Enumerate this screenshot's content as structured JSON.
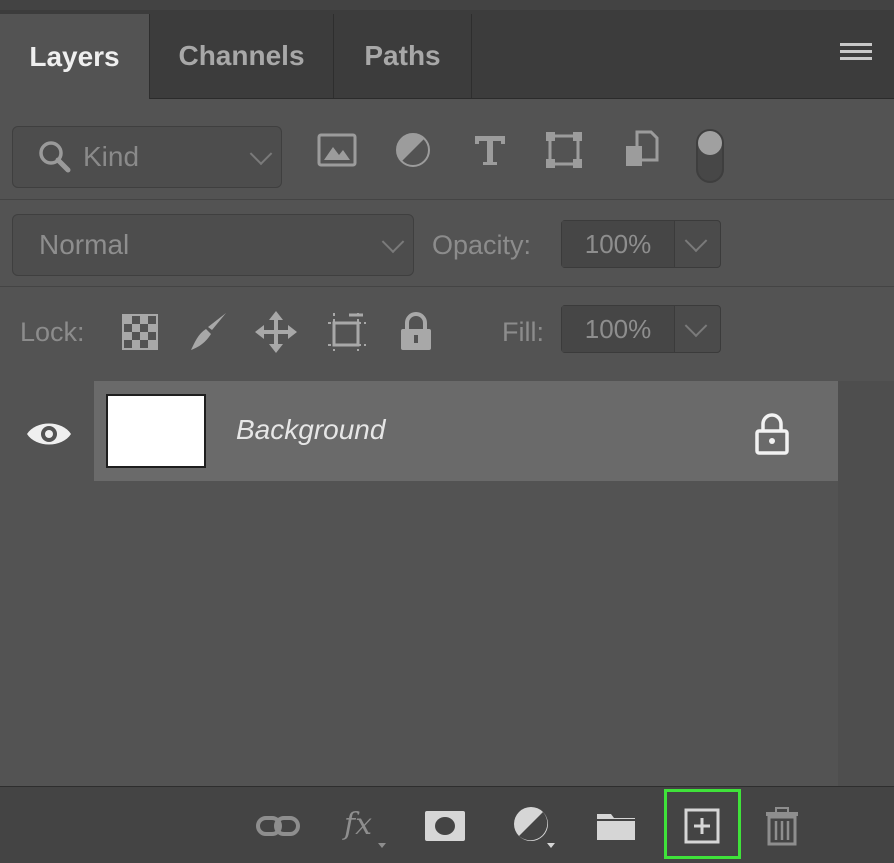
{
  "tabs": [
    {
      "label": "Layers",
      "active": true
    },
    {
      "label": "Channels",
      "active": false
    },
    {
      "label": "Paths",
      "active": false
    }
  ],
  "filter": {
    "kind_label": "Kind",
    "icons": [
      "image-filter-icon",
      "adjustment-filter-icon",
      "type-filter-icon",
      "shape-filter-icon",
      "smart-object-filter-icon",
      "filter-toggle-icon"
    ]
  },
  "blend": {
    "mode": "Normal",
    "opacity_label": "Opacity:",
    "opacity_value": "100%"
  },
  "lock": {
    "label": "Lock:",
    "fill_label": "Fill:",
    "fill_value": "100%"
  },
  "layers": [
    {
      "name": "Background",
      "visible": true,
      "locked": true,
      "thumb_color": "#ffffff"
    }
  ],
  "bottom_icons": [
    "link-icon",
    "fx-icon",
    "mask-icon",
    "adjustment-icon",
    "folder-icon",
    "new-layer-icon",
    "trash-icon"
  ],
  "colors": {
    "panel": "#535353",
    "tabbar": "#3c3c3c",
    "selected_layer": "#6a6a6a",
    "highlight": "#3fe23a"
  }
}
